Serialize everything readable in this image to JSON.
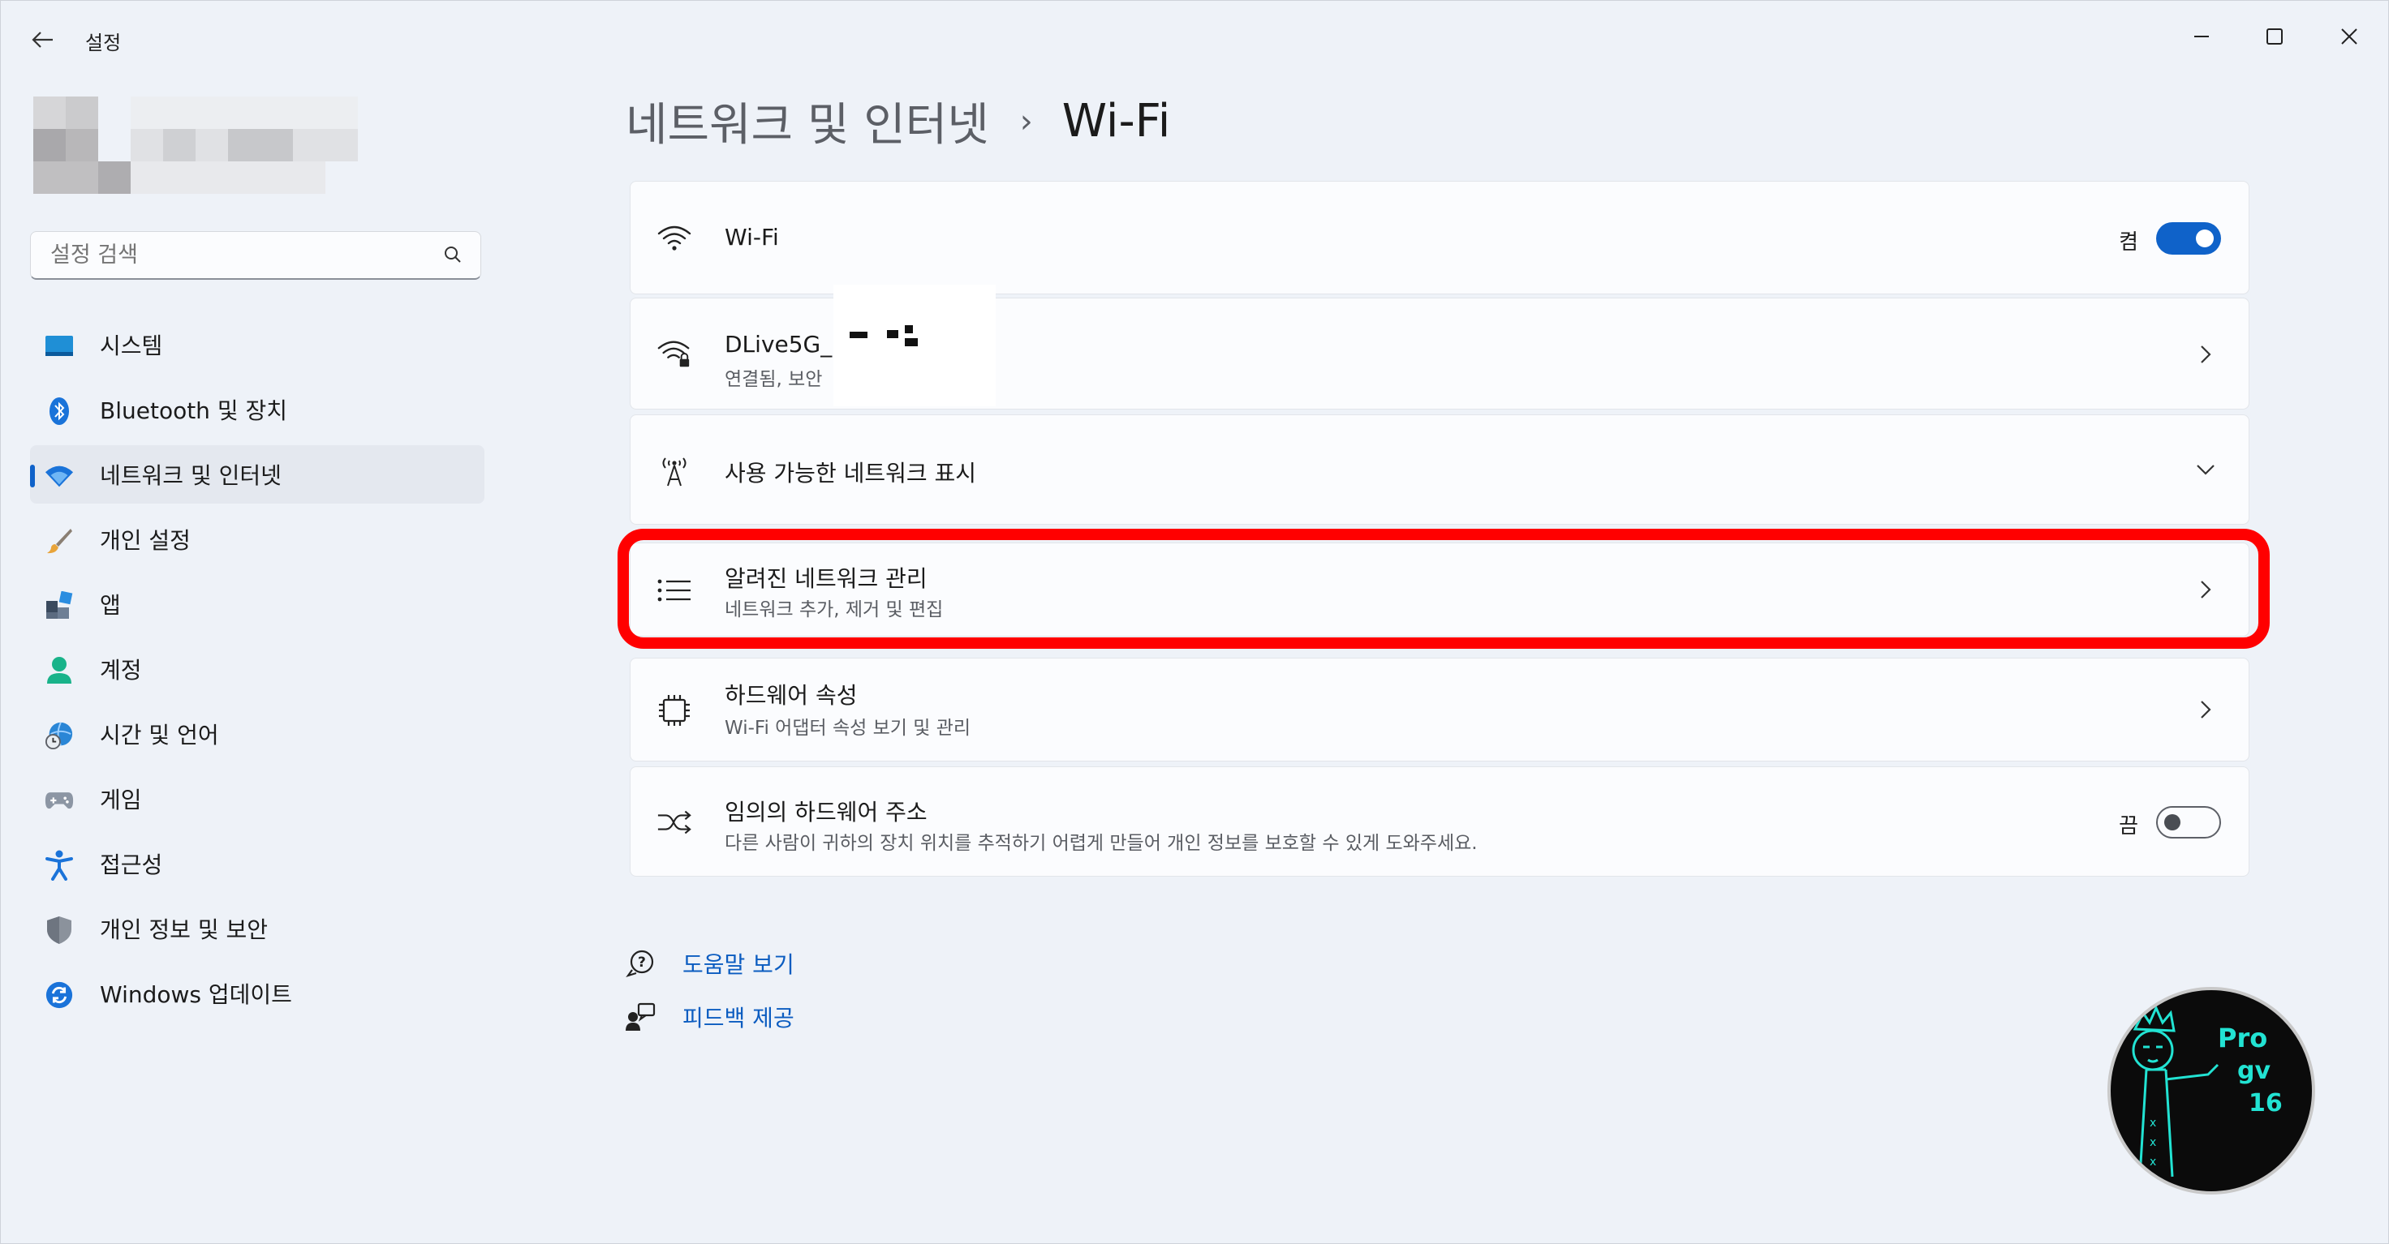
{
  "window": {
    "title": "설정"
  },
  "search": {
    "placeholder": "설정 검색"
  },
  "sidebar": {
    "items": [
      {
        "label": "시스템",
        "icon": "monitor-icon"
      },
      {
        "label": "Bluetooth 및 장치",
        "icon": "bluetooth-icon"
      },
      {
        "label": "네트워크 및 인터넷",
        "icon": "wifi-icon",
        "active": true
      },
      {
        "label": "개인 설정",
        "icon": "paintbrush-icon"
      },
      {
        "label": "앱",
        "icon": "apps-icon"
      },
      {
        "label": "계정",
        "icon": "person-icon"
      },
      {
        "label": "시간 및 언어",
        "icon": "globe-clock-icon"
      },
      {
        "label": "게임",
        "icon": "gamepad-icon"
      },
      {
        "label": "접근성",
        "icon": "accessibility-icon"
      },
      {
        "label": "개인 정보 및 보안",
        "icon": "shield-icon"
      },
      {
        "label": "Windows 업데이트",
        "icon": "update-icon"
      }
    ]
  },
  "breadcrumb": {
    "parent": "네트워크 및 인터넷",
    "separator": "›",
    "current": "Wi-Fi"
  },
  "cards": {
    "wifi": {
      "title": "Wi-Fi",
      "state": "켬",
      "on": true
    },
    "connected": {
      "title": "DLive5G_5",
      "subtitle": "연결됨, 보안"
    },
    "available": {
      "title": "사용 가능한 네트워크 표시"
    },
    "known": {
      "title": "알려진 네트워크 관리",
      "subtitle": "네트워크 추가, 제거 및 편집"
    },
    "hardware": {
      "title": "하드웨어 속성",
      "subtitle": "Wi-Fi 어댑터 속성 보기 및 관리"
    },
    "random": {
      "title": "임의의 하드웨어 주소",
      "subtitle": "다른 사람이 귀하의 장치 위치를 추적하기 어렵게 만들어 개인 정보를 보호할 수 있게 도와주세요.",
      "state": "끔",
      "on": false
    }
  },
  "links": {
    "help": "도움말 보기",
    "feedback": "피드백 제공"
  },
  "badge": {
    "line1": "Pro",
    "line2": "gv",
    "line3": "16"
  },
  "colors": {
    "accent": "#0f62c9",
    "highlight": "#ff0000",
    "badge_text": "#22e3d3"
  }
}
